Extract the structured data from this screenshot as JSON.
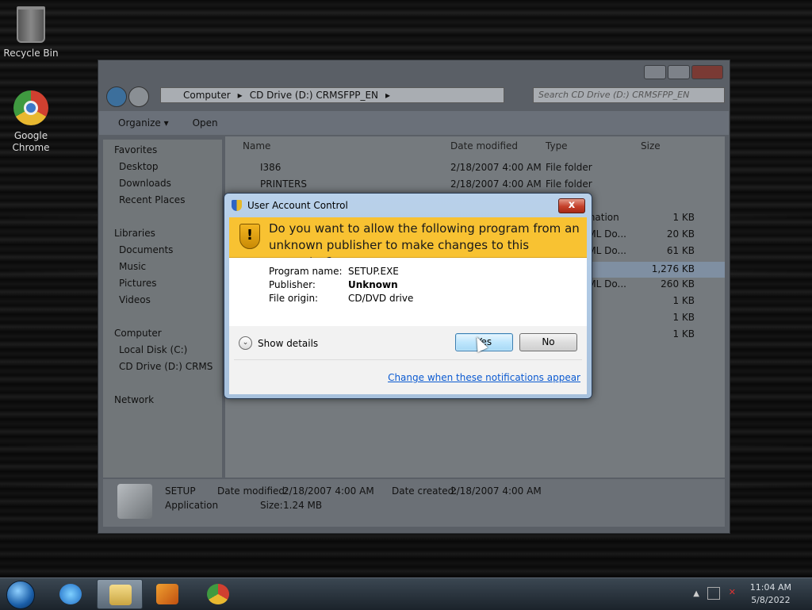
{
  "desktop": {
    "icons": [
      {
        "label": "Recycle Bin",
        "icon": "recycle-bin-icon"
      },
      {
        "label": "Google Chrome",
        "icon": "chrome-icon"
      }
    ]
  },
  "explorer": {
    "breadcrumb": [
      "Computer",
      "CD Drive (D:) CRMSFPP_EN"
    ],
    "search_placeholder": "Search CD Drive (D:) CRMSFPP_EN",
    "toolbar": {
      "organize": "Organize ▾",
      "open": "Open"
    },
    "nav": {
      "favorites": "Favorites",
      "desktop": "Desktop",
      "downloads": "Downloads",
      "recent": "Recent Places",
      "libraries": "Libraries",
      "documents": "Documents",
      "music": "Music",
      "pictures": "Pictures",
      "videos": "Videos",
      "computer": "Computer",
      "local_disk": "Local Disk (C:)",
      "cd_drive": "CD Drive (D:) CRMS",
      "network": "Network"
    },
    "columns": {
      "name": "Name",
      "date": "Date modified",
      "type": "Type",
      "size": "Size"
    },
    "files": [
      {
        "name": "I386",
        "date": "2/18/2007 4:00 AM",
        "type": "File folder",
        "size": ""
      },
      {
        "name": "PRINTERS",
        "date": "2/18/2007 4:00 AM",
        "type": "File folder",
        "size": ""
      },
      {
        "name": "",
        "date": "",
        "type": "rmation",
        "size": "1 KB"
      },
      {
        "name": "",
        "date": "",
        "type": "TML Do...",
        "size": "20 KB"
      },
      {
        "name": "",
        "date": "",
        "type": "TML Do...",
        "size": "61 KB"
      },
      {
        "name": "",
        "date": "",
        "type": "",
        "size": "1,276 KB"
      },
      {
        "name": "",
        "date": "",
        "type": "TML Do...",
        "size": "260 KB"
      },
      {
        "name": "",
        "date": "",
        "type": "",
        "size": "1 KB"
      },
      {
        "name": "",
        "date": "",
        "type": "",
        "size": "1 KB"
      },
      {
        "name": "",
        "date": "",
        "type": "",
        "size": "1 KB"
      }
    ],
    "details": {
      "name": "SETUP",
      "kind": "Application",
      "modified_label": "Date modified:",
      "modified_value": "2/18/2007 4:00 AM",
      "size_label": "Size:",
      "size_value": "1.24 MB",
      "created_label": "Date created:",
      "created_value": "2/18/2007 4:00 AM"
    }
  },
  "uac": {
    "title": "User Account Control",
    "close_glyph": "x",
    "question": "Do you want to allow the following program from an unknown publisher to make changes to this computer?",
    "program_name_label": "Program name:",
    "program_name": "SETUP.EXE",
    "publisher_label": "Publisher:",
    "publisher": "Unknown",
    "origin_label": "File origin:",
    "origin": "CD/DVD drive",
    "show_details": "Show details",
    "yes": "Yes",
    "no": "No",
    "link": "Change when these notifications appear"
  },
  "taskbar": {
    "time": "11:04 AM",
    "date": "5/8/2022"
  }
}
